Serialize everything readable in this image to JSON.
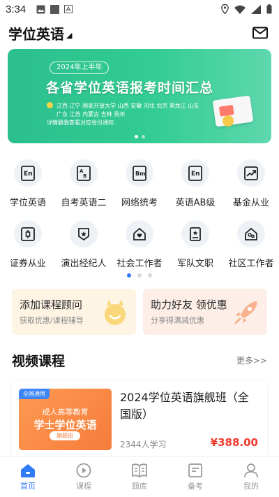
{
  "status_bar": {
    "time": "3:34"
  },
  "header": {
    "title": "学位英语",
    "caret": "◢"
  },
  "banner": {
    "pill": "2024年上半年",
    "headline": "各省学位英语报考时间汇总",
    "line1": "江西  辽宁  国家开放大学  山西  安徽  河北    北京  黑龙江    山东",
    "line2": "广东  江苏  内蒙古  吉林  贵州",
    "notice": "详情戳我查看对应省份通知"
  },
  "categories_page1": [
    {
      "label": "学位英语",
      "icon": "en-book-icon"
    },
    {
      "label": "自考英语二",
      "icon": "ab-book-icon"
    },
    {
      "label": "网络统考",
      "icon": "bm-book-icon"
    },
    {
      "label": "英语AB级",
      "icon": "en-book-icon"
    },
    {
      "label": "基金从业",
      "icon": "chart-up-icon"
    },
    {
      "label": "证券从业",
      "icon": "candlestick-icon"
    },
    {
      "label": "演出经纪人",
      "icon": "star-badge-icon"
    },
    {
      "label": "社会工作者",
      "icon": "house-heart-icon"
    },
    {
      "label": "军队文职",
      "icon": "star-document-icon"
    },
    {
      "label": "社区工作者",
      "icon": "people-house-icon"
    }
  ],
  "promos": [
    {
      "title": "添加课程顾问",
      "subtitle": "获取优惠/课程辅导"
    },
    {
      "title": "助力好友 领优惠",
      "subtitle": "分享得满减优惠"
    }
  ],
  "section": {
    "title": "视频课程",
    "more": "更多>>"
  },
  "course": {
    "thumb_tag": "全国通用",
    "thumb_line1": "成人高等教育",
    "thumb_line2": "学士学位英语",
    "thumb_badge": "旗舰班",
    "name": "2024学位英语旗舰班（全国版）",
    "learners": "2344人学习",
    "price": "¥388.00"
  },
  "tabbar": [
    {
      "label": "首页",
      "icon": "home-icon",
      "active": true
    },
    {
      "label": "课程",
      "icon": "play-icon",
      "active": false
    },
    {
      "label": "题库",
      "icon": "book-icon",
      "active": false
    },
    {
      "label": "备考",
      "icon": "clipboard-icon",
      "active": false
    },
    {
      "label": "我的",
      "icon": "user-icon",
      "active": false
    }
  ],
  "colors": {
    "accent": "#2f7cf6",
    "banner": "#33cc94",
    "price": "#ef3b2e"
  }
}
